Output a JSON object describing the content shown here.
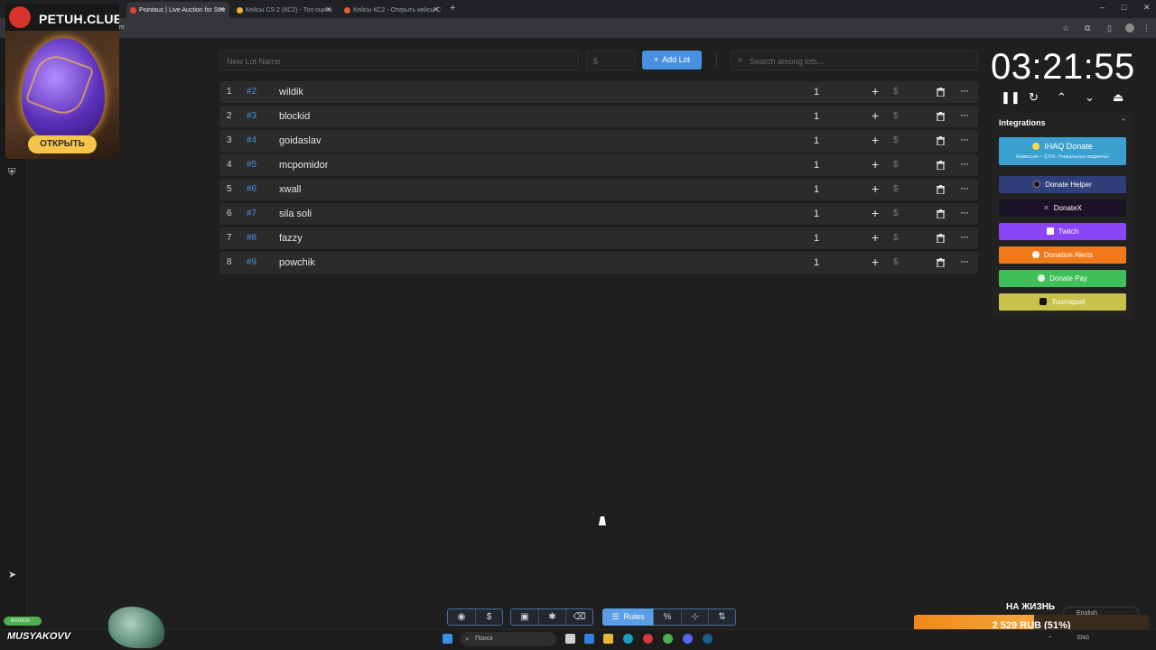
{
  "browser": {
    "tabs": [
      {
        "title": "Pointauc | Live Auction for Stre",
        "active": true
      },
      {
        "title": "Кейсы CS 2 (КС2) - Топ оцинк"
      },
      {
        "title": "Кейсы КС2 - Открыть кейсы С"
      }
    ],
    "new_tab": "+",
    "address": "om"
  },
  "promo": {
    "brand": "PETUH.CLUB",
    "button": "ОТКРЫТЬ"
  },
  "lot_form": {
    "name_placeholder": "New Lot Name",
    "amount_placeholder": "$",
    "add_button": "Add Lot",
    "search_placeholder": "Search among lots..."
  },
  "lots": [
    {
      "index": "1",
      "number": "#2",
      "name": "wildik",
      "amount": "1"
    },
    {
      "index": "2",
      "number": "#3",
      "name": "blockid",
      "amount": "1"
    },
    {
      "index": "3",
      "number": "#4",
      "name": "goidaslav",
      "amount": "1"
    },
    {
      "index": "4",
      "number": "#5",
      "name": "mcpomidor",
      "amount": "1"
    },
    {
      "index": "5",
      "number": "#6",
      "name": "xwall",
      "amount": "1"
    },
    {
      "index": "6",
      "number": "#7",
      "name": "sila soli",
      "amount": "1"
    },
    {
      "index": "7",
      "number": "#8",
      "name": "fazzy",
      "amount": "1"
    },
    {
      "index": "8",
      "number": "#9",
      "name": "powchik",
      "amount": "1"
    }
  ],
  "row_icons": {
    "plus": "+",
    "dollar": "$",
    "more": "···"
  },
  "timer": {
    "value": "03:21:55"
  },
  "integrations": {
    "title": "Integrations",
    "ihaq": {
      "title": "IHAQ Donate",
      "subtitle": "Комиссия – 3,5%. Уникальные виджеты!",
      "color": "#3aa0d0"
    },
    "items": [
      {
        "label": "Donate Helper",
        "color": "#2f3f7a"
      },
      {
        "label": "DonateX",
        "color": "#1a1226"
      },
      {
        "label": "Twitch",
        "color": "#8c44f7"
      },
      {
        "label": "Donation Alerts",
        "color": "#f07a1a"
      },
      {
        "label": "Donate Pay",
        "color": "#3fbf5a"
      },
      {
        "label": "Tourniquet",
        "color": "#c9c24a"
      }
    ]
  },
  "toolbar": {
    "rules_label": "Rules",
    "percent": "%"
  },
  "goal": {
    "title": "НА ЖИЗНЬ",
    "language": "English",
    "progress_text": "2 529 RUB (51%)",
    "progress": 0.51,
    "min": "0",
    "max": "5000"
  },
  "streamer": {
    "name": "MUSYAKOVV",
    "badge": "ФОЛЛОУ"
  },
  "taskbar": {
    "search": "Поиск",
    "lang": "ENG"
  }
}
